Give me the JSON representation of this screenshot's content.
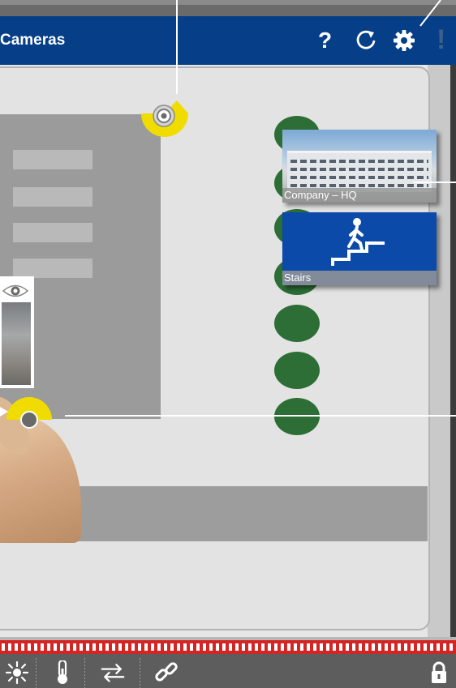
{
  "header": {
    "title": "Cameras",
    "help_label": "?",
    "alert_label": "!"
  },
  "cameras": [
    {
      "label": "Company – HQ",
      "image": "building-photo"
    },
    {
      "label": "Stairs",
      "image": "stairs-pictogram"
    }
  ],
  "icons": {
    "refresh": "refresh-icon",
    "settings": "gear-icon",
    "view": "eye-icon",
    "lock": "lock-icon",
    "toolbar": [
      "brightness-icon",
      "thermometer-icon",
      "switch-icon",
      "link-icon"
    ]
  },
  "colors": {
    "header": "#063f87",
    "camera_marker": "#f0dc00",
    "node": "#2c6e35",
    "timeline": "#d42525"
  }
}
